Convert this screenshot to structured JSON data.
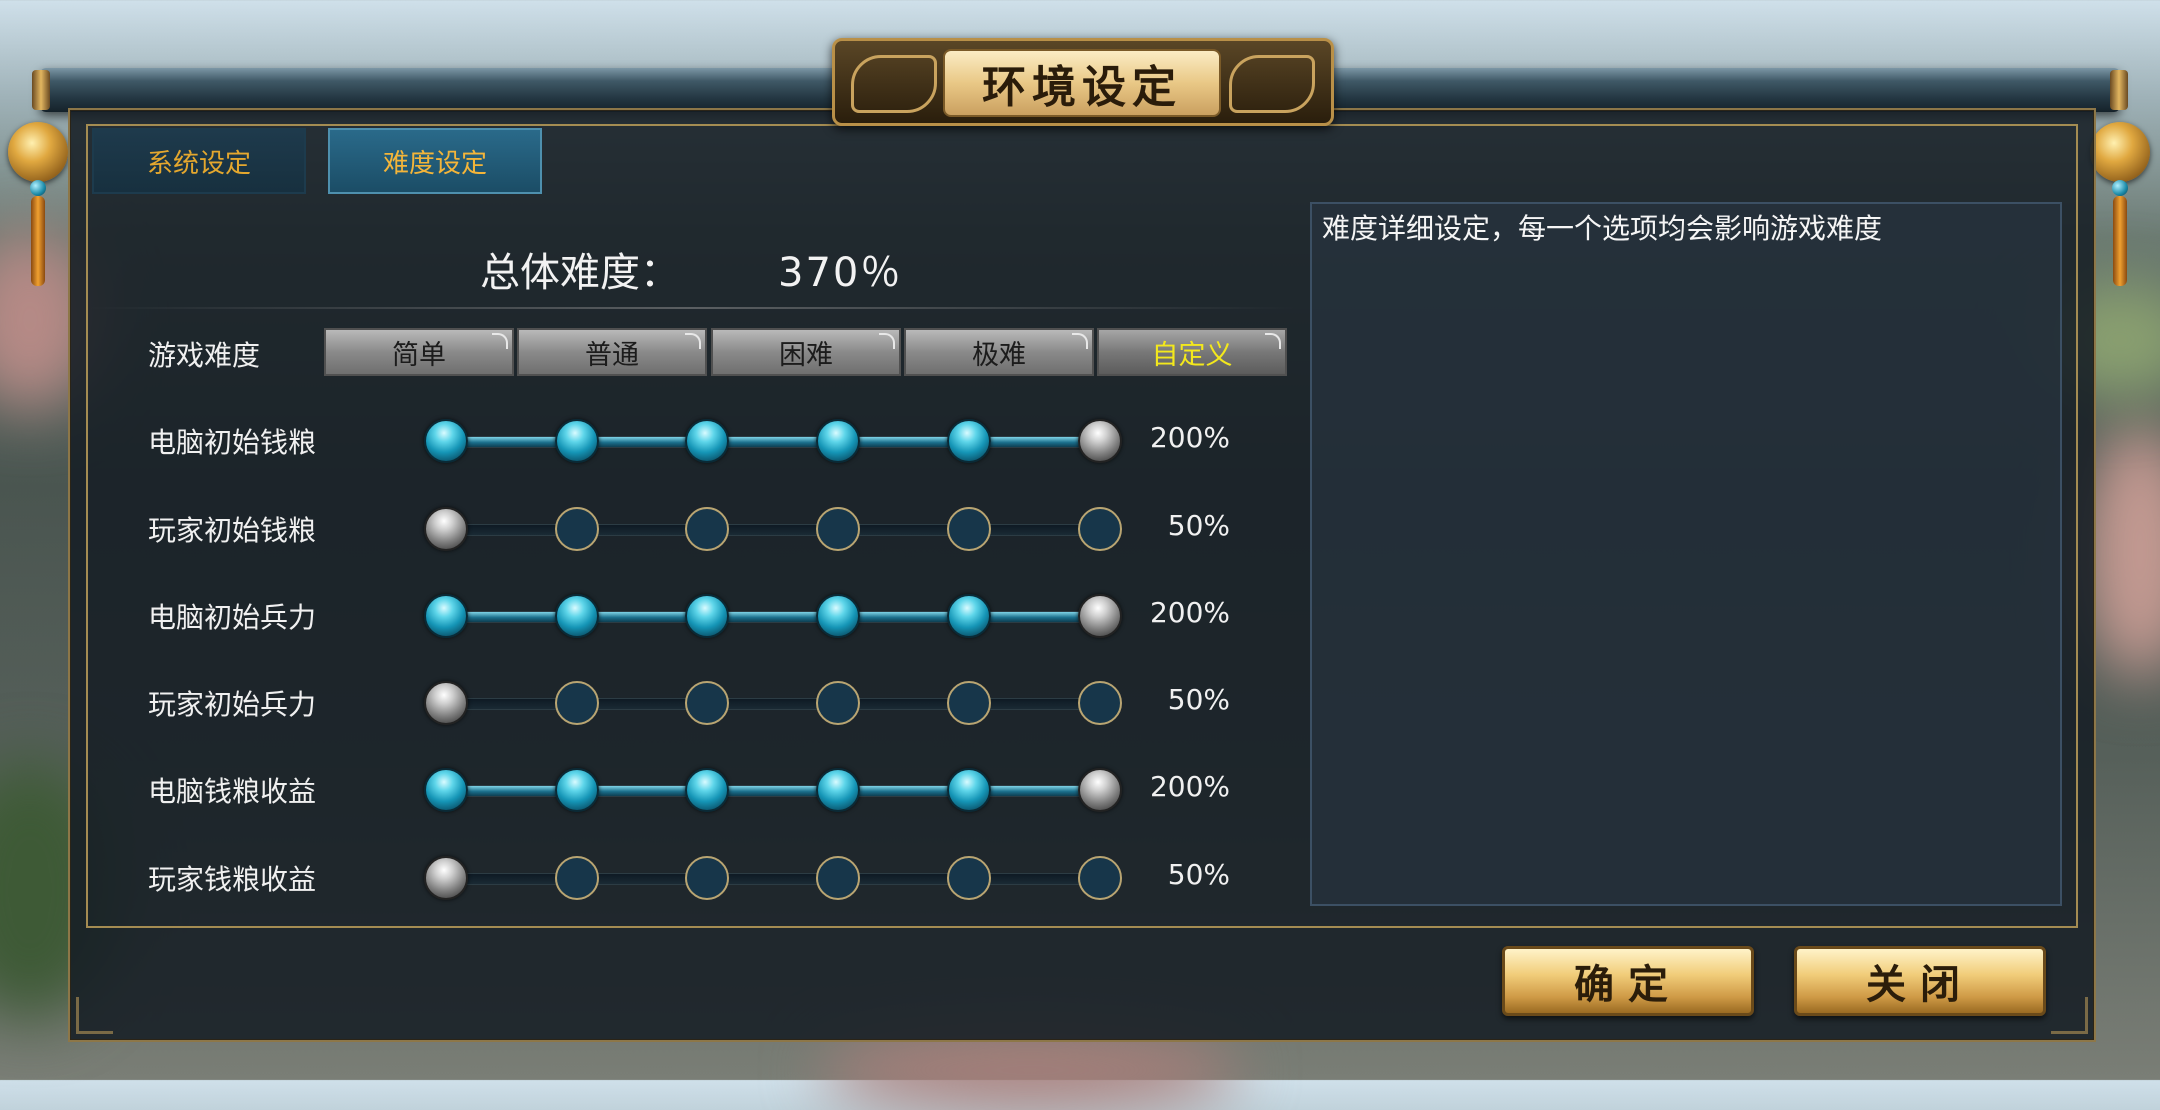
{
  "window": {
    "title": "环境设定"
  },
  "tabs": [
    {
      "label": "系统设定",
      "active": false
    },
    {
      "label": "难度设定",
      "active": true
    }
  ],
  "overall": {
    "label": "总体难度：",
    "value": "370％"
  },
  "difficulty": {
    "label": "游戏难度",
    "options": [
      "简单",
      "普通",
      "困难",
      "极难",
      "自定义"
    ],
    "selected": "自定义"
  },
  "settings": [
    {
      "label": "电脑初始钱粮",
      "level": 6,
      "steps": 6,
      "value": "200%"
    },
    {
      "label": "玩家初始钱粮",
      "level": 1,
      "steps": 6,
      "value": "50%"
    },
    {
      "label": "电脑初始兵力",
      "level": 6,
      "steps": 6,
      "value": "200%"
    },
    {
      "label": "玩家初始兵力",
      "level": 1,
      "steps": 6,
      "value": "50%"
    },
    {
      "label": "电脑钱粮收益",
      "level": 6,
      "steps": 6,
      "value": "200%"
    },
    {
      "label": "玩家钱粮收益",
      "level": 1,
      "steps": 6,
      "value": "50%"
    }
  ],
  "description": {
    "text": "难度详细设定，每一个选项均会影响游戏难度"
  },
  "buttons": {
    "confirm": "确定",
    "close": "关闭"
  },
  "colors": {
    "accent_gold": "#e4a72e",
    "selected_yellow": "#f3e81c",
    "slider_teal": "#1595b6"
  },
  "icons": {
    "ornament": "gold-medallion-icon",
    "title_deco": "cloud-swirl-icon"
  }
}
